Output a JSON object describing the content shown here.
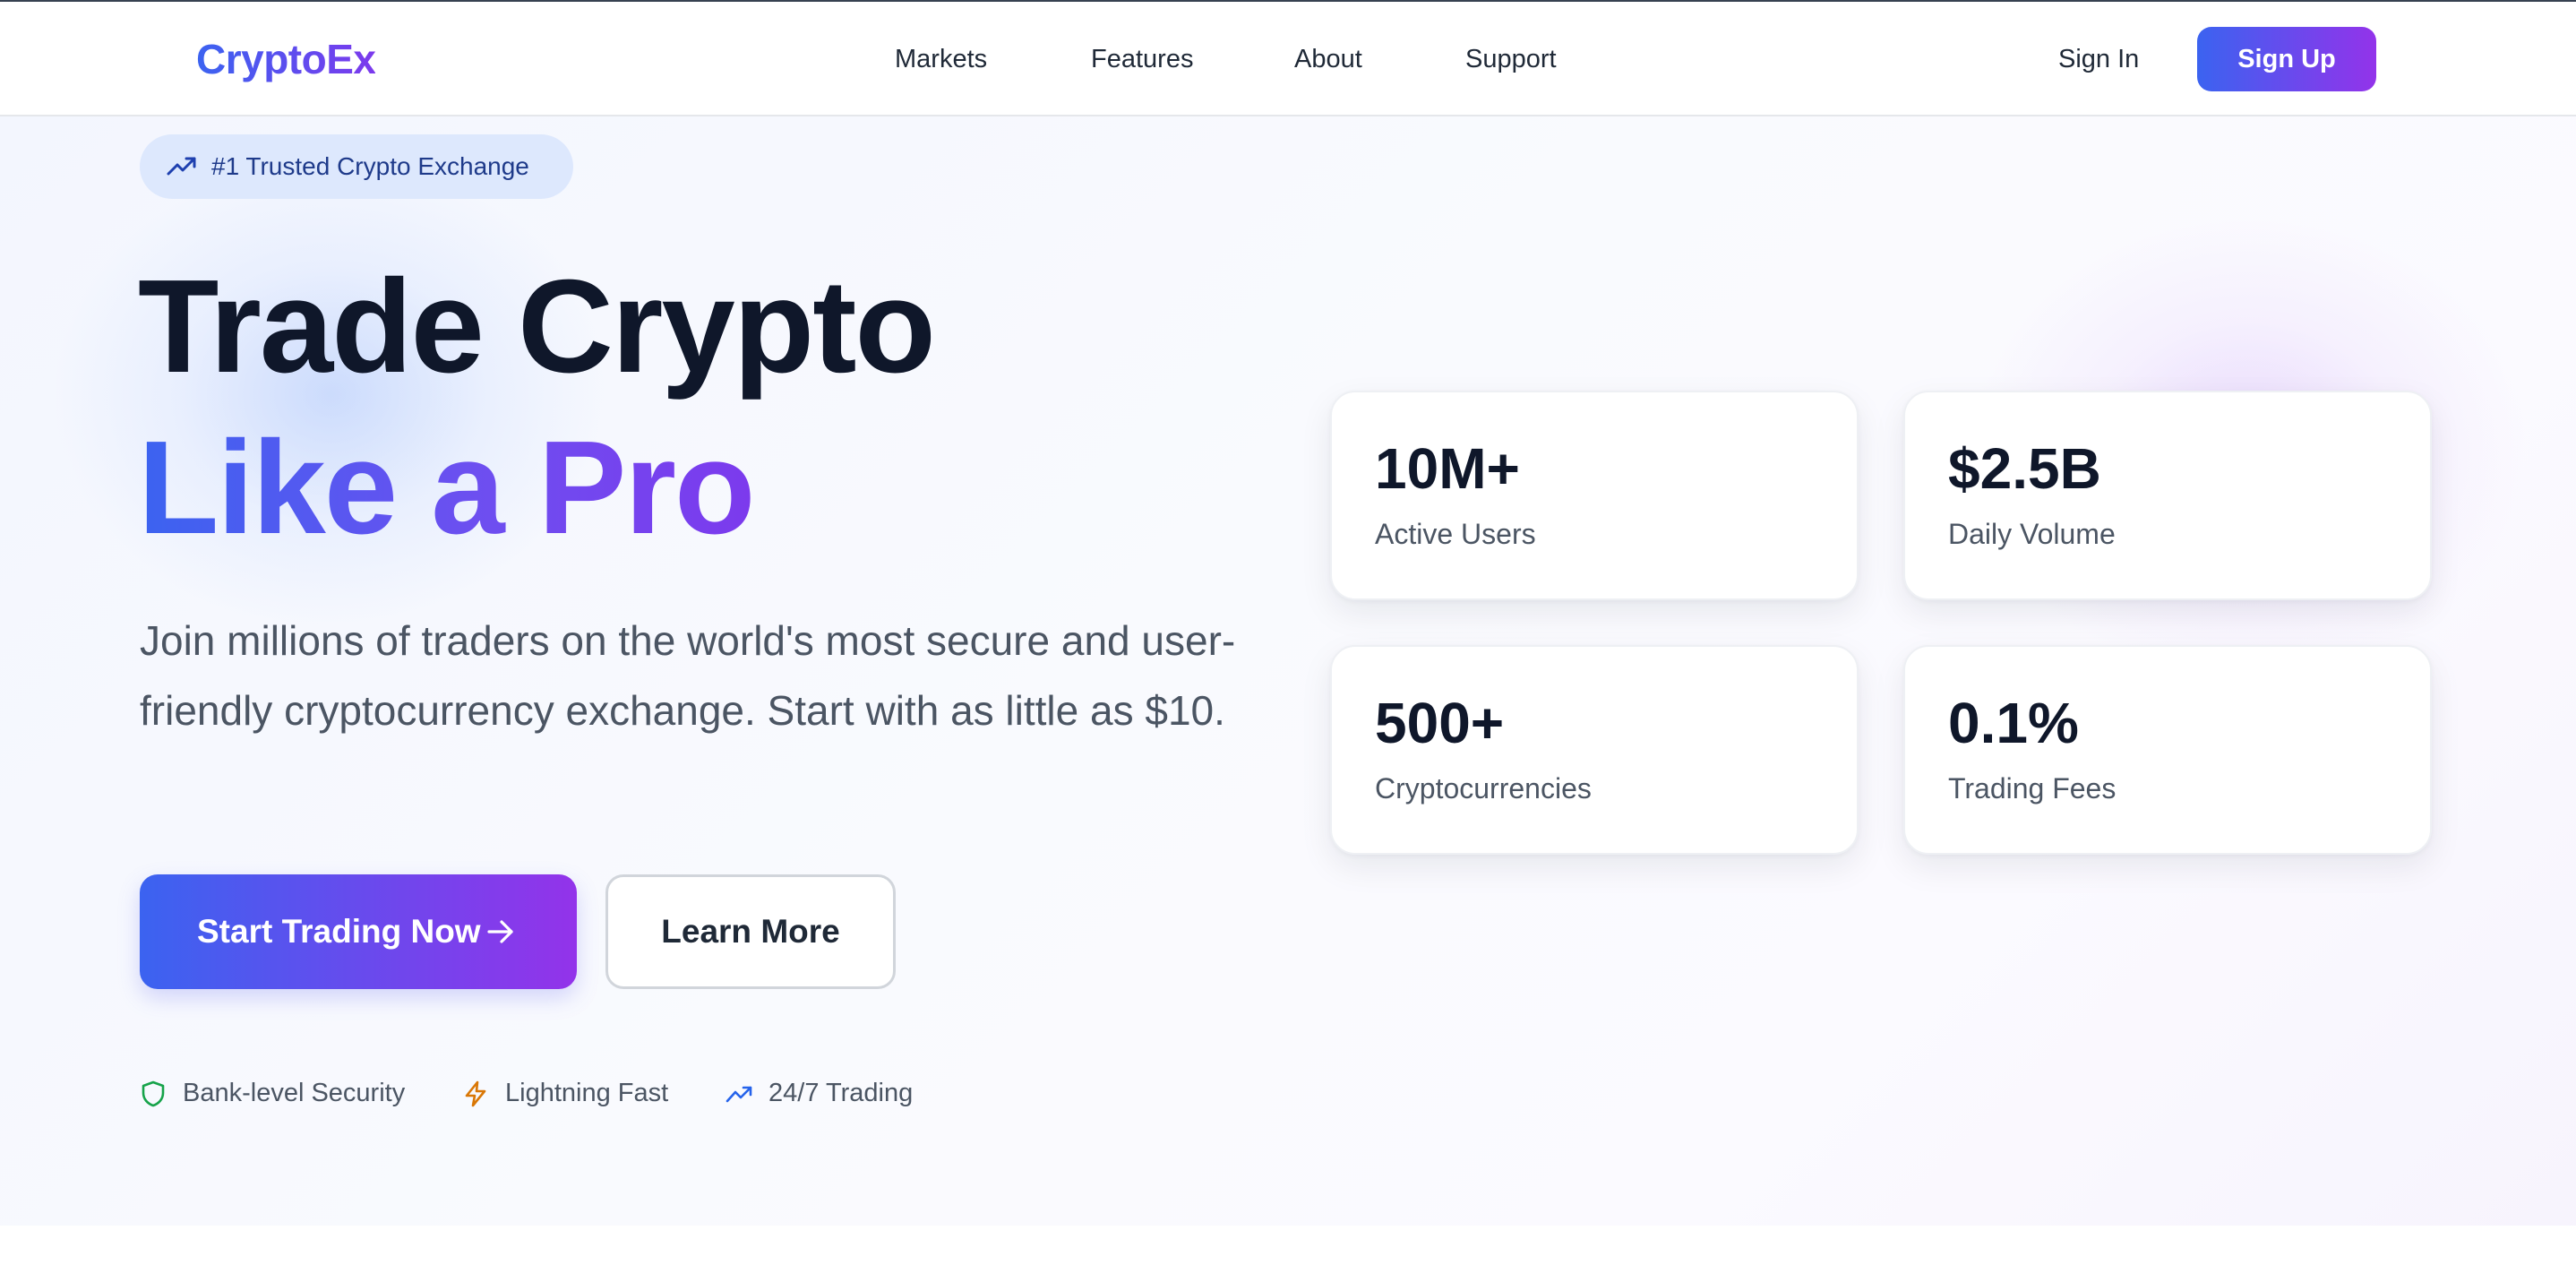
{
  "header": {
    "logo": "CryptoEx",
    "nav": [
      "Markets",
      "Features",
      "About",
      "Support"
    ],
    "sign_in": "Sign In",
    "sign_up": "Sign Up"
  },
  "hero": {
    "badge": "#1 Trusted Crypto Exchange",
    "headline_line1": "Trade Crypto",
    "headline_line2": "Like a Pro",
    "subtext": "Join millions of traders on the world's most secure and user-friendly cryptocurrency exchange. Start with as little as $10.",
    "cta_primary": "Start Trading Now",
    "cta_secondary": "Learn More",
    "features": [
      {
        "label": "Bank-level Security",
        "icon": "shield-icon",
        "color": "#16a34a"
      },
      {
        "label": "Lightning Fast",
        "icon": "lightning-icon",
        "color": "#d97706"
      },
      {
        "label": "24/7 Trading",
        "icon": "trending-up-icon",
        "color": "#2563eb"
      }
    ]
  },
  "stats": [
    {
      "value": "10M+",
      "label": "Active Users"
    },
    {
      "value": "$2.5B",
      "label": "Daily Volume"
    },
    {
      "value": "500+",
      "label": "Cryptocurrencies"
    },
    {
      "value": "0.1%",
      "label": "Trading Fees"
    }
  ],
  "colors": {
    "accent_blue": "#3b63f0",
    "accent_purple": "#9333ea",
    "heading": "#0f172a",
    "body_text": "#4b5563"
  }
}
